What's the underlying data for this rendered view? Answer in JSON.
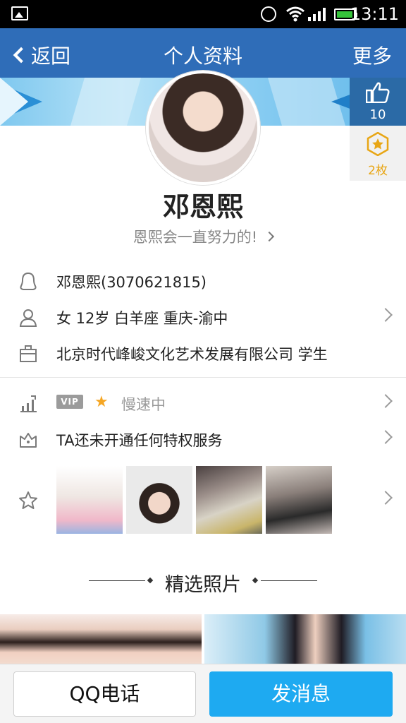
{
  "status_bar": {
    "time": "13:11"
  },
  "nav": {
    "back_label": "返回",
    "title": "个人资料",
    "more_label": "更多"
  },
  "likes": {
    "count": "10"
  },
  "medals": {
    "count": "2枚"
  },
  "profile": {
    "name": "邓恩熙",
    "signature": "恩熙会一直努力的!"
  },
  "info": {
    "account": "邓恩熙(3070621815)",
    "basic": "女  12岁  白羊座  重庆-渝中",
    "work": "北京时代峰峻文化艺术发展有限公司 学生"
  },
  "vip": {
    "badge": "VIP",
    "status": "慢速中"
  },
  "privilege": {
    "text": "TA还未开通任何特权服务"
  },
  "featured": {
    "title": "精选照片"
  },
  "actions": {
    "call_label": "QQ电话",
    "message_label": "发消息"
  },
  "colors": {
    "nav": "#2f6db8",
    "primary_button": "#1eaaf1",
    "medal": "#e8a615"
  }
}
